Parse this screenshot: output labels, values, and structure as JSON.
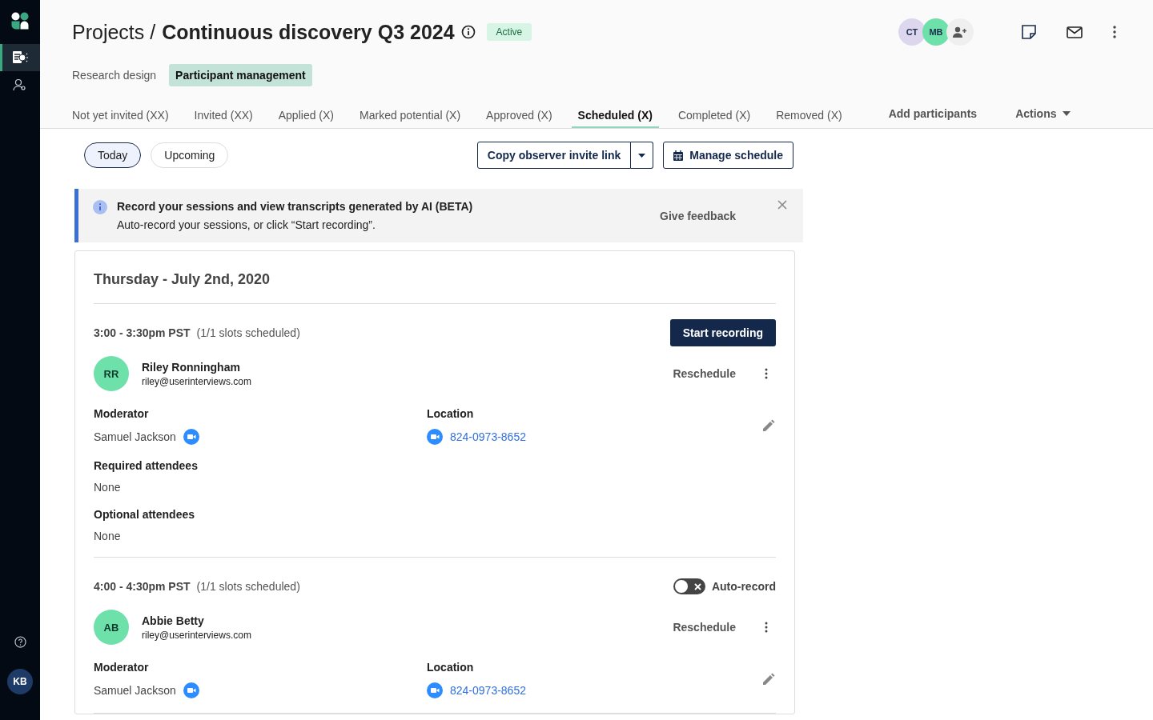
{
  "sidebar": {
    "nav": [
      {
        "kind": "research",
        "selected": true
      },
      {
        "kind": "people",
        "selected": false
      }
    ],
    "user": {
      "initials": "KB"
    }
  },
  "header": {
    "breadcrumb": "Projects /",
    "title": "Continuous discovery Q3 2024",
    "status": "Active",
    "avatars": [
      {
        "initials": "CT",
        "color": "#ddd6ef"
      },
      {
        "initials": "MB",
        "color": "#6ee0aa"
      }
    ]
  },
  "subtabs": [
    {
      "label": "Research design",
      "selected": false
    },
    {
      "label": "Participant management",
      "selected": true
    }
  ],
  "tabs": [
    {
      "label": "Not yet invited (XX)",
      "selected": false
    },
    {
      "label": "Invited (XX)",
      "selected": false
    },
    {
      "label": "Applied (X)",
      "selected": false
    },
    {
      "label": "Marked potential (X)",
      "selected": false
    },
    {
      "label": "Approved (X)",
      "selected": false
    },
    {
      "label": "Scheduled (X)",
      "selected": true
    },
    {
      "label": "Completed (X)",
      "selected": false
    },
    {
      "label": "Removed (X)",
      "selected": false
    }
  ],
  "tab_actions": {
    "add": "Add participants",
    "actions": "Actions"
  },
  "filters": [
    {
      "label": "Today",
      "selected": true
    },
    {
      "label": "Upcoming",
      "selected": false
    }
  ],
  "buttons": {
    "copy": "Copy observer invite link",
    "manage": "Manage schedule"
  },
  "banner": {
    "title": "Record your sessions and view transcripts generated by AI (BETA)",
    "text": "Auto-record your sessions, or click “Start recording”.",
    "feedback": "Give feedback"
  },
  "day": "Thursday - July 2nd, 2020",
  "slots": [
    {
      "time": "3:00 - 3:30pm PST",
      "count": "(1/1 slots scheduled)",
      "kind": "record_button",
      "action": "Start recording",
      "participant": {
        "initials": "RR",
        "name": "Riley Ronningham",
        "email": "riley@userinterviews.com"
      },
      "reschedule": "Reschedule",
      "moderator": {
        "label": "Moderator",
        "name": "Samuel Jackson"
      },
      "location": {
        "label": "Location",
        "number": "824-0973-8652"
      },
      "attendees": [
        {
          "label": "Required attendees",
          "value": "None"
        },
        {
          "label": "Optional attendees",
          "value": "None"
        }
      ]
    },
    {
      "time": "4:00 - 4:30pm PST",
      "count": "(1/1 slots scheduled)",
      "kind": "auto_record",
      "action": "Auto-record",
      "on": false,
      "participant": {
        "initials": "AB",
        "name": "Abbie Betty",
        "email": "riley@userinterviews.com"
      },
      "reschedule": "Reschedule",
      "moderator": {
        "label": "Moderator",
        "name": "Samuel Jackson"
      },
      "location": {
        "label": "Location",
        "number": "824-0973-8652"
      }
    }
  ]
}
